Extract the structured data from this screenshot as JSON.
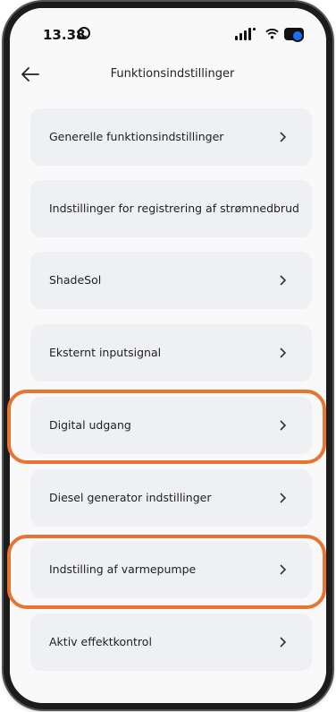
{
  "status_bar": {
    "time": "13.38"
  },
  "header": {
    "title": "Funktionsindstillinger"
  },
  "menu": {
    "items": [
      {
        "label": "Generelle funktionsindstillinger",
        "has_chevron": true
      },
      {
        "label": "Indstillinger for registrering af strømnedbrud",
        "has_chevron": false
      },
      {
        "label": "ShadeSol",
        "has_chevron": true
      },
      {
        "label": "Eksternt inputsignal",
        "has_chevron": true
      },
      {
        "label": "Digital udgang",
        "has_chevron": true,
        "highlighted": true
      },
      {
        "label": "Diesel generator indstillinger",
        "has_chevron": true
      },
      {
        "label": "Indstilling af varmepumpe",
        "has_chevron": true,
        "highlighted": true
      },
      {
        "label": "Aktiv effektkontrol",
        "has_chevron": true
      }
    ]
  },
  "colors": {
    "highlight": "#e97432",
    "card_background": "#eef0f3",
    "screen_background": "#f9f9f9"
  }
}
